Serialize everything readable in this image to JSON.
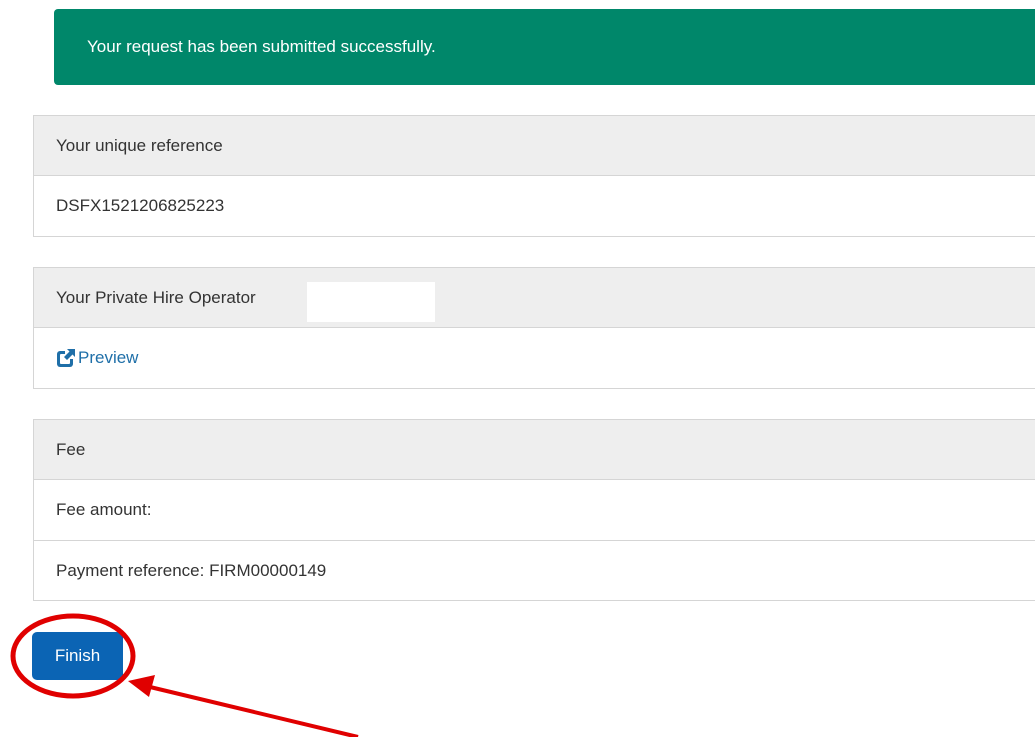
{
  "alert": {
    "message": "Your request has been submitted successfully.",
    "color": "#00876a"
  },
  "reference_panel": {
    "heading": "Your unique reference",
    "value": "DSFX1521206825223"
  },
  "operator_panel": {
    "heading": "Your Private Hire Operator",
    "preview_label": "Preview",
    "preview_icon": "external-link-icon"
  },
  "fee_panel": {
    "heading": "Fee",
    "fee_amount_label": "Fee amount:",
    "payment_reference": "Payment reference: FIRM00000149"
  },
  "actions": {
    "finish_label": "Finish",
    "button_color": "#0b64b4"
  },
  "annotation": {
    "color": "#e00000",
    "shapes": [
      "circle-highlight",
      "arrow"
    ]
  }
}
